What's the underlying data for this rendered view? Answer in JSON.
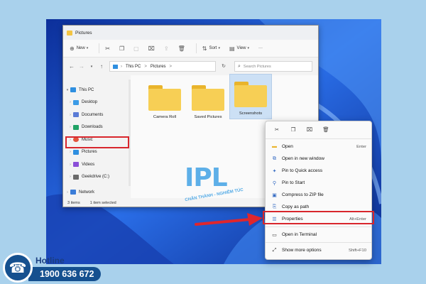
{
  "window": {
    "title": "Pictures"
  },
  "toolbar": {
    "new_label": "New",
    "sort_label": "Sort",
    "view_label": "View",
    "more_label": "···"
  },
  "address": {
    "crumbs": [
      "This PC",
      ">",
      "Pictures",
      ">"
    ],
    "search_placeholder": "Search Pictures"
  },
  "nav": {
    "items": [
      {
        "label": "This PC",
        "icon": "computer-icon",
        "color": "#2f8fe0"
      },
      {
        "label": "Desktop",
        "icon": "desktop-icon",
        "color": "#3b9be6"
      },
      {
        "label": "Documents",
        "icon": "documents-icon",
        "color": "#5a7bd6"
      },
      {
        "label": "Downloads",
        "icon": "downloads-icon",
        "color": "#21a366"
      },
      {
        "label": "Music",
        "icon": "music-icon",
        "color": "#e2533d"
      },
      {
        "label": "Pictures",
        "icon": "pictures-icon",
        "color": "#2f8fe0"
      },
      {
        "label": "Videos",
        "icon": "videos-icon",
        "color": "#8b4fd8"
      },
      {
        "label": "Geekdrive (C:)",
        "icon": "drive-icon",
        "color": "#6b6b6b"
      },
      {
        "label": "Network",
        "icon": "network-icon",
        "color": "#3b7dd8"
      }
    ]
  },
  "files": [
    {
      "name": "Camera Roll"
    },
    {
      "name": "Saved Pictures"
    },
    {
      "name": "Screenshots"
    }
  ],
  "status": {
    "count": "3 items",
    "selected": "1 item selected"
  },
  "context_menu": {
    "items": [
      {
        "label": "Open",
        "shortcut": "Enter",
        "icon": "open-icon"
      },
      {
        "label": "Open in new window",
        "shortcut": "",
        "icon": "new-window-icon"
      },
      {
        "label": "Pin to Quick access",
        "shortcut": "",
        "icon": "pin-icon"
      },
      {
        "label": "Pin to Start",
        "shortcut": "",
        "icon": "pin-start-icon"
      },
      {
        "label": "Compress to ZIP file",
        "shortcut": "",
        "icon": "zip-icon"
      },
      {
        "label": "Copy as path",
        "shortcut": "",
        "icon": "copy-path-icon"
      },
      {
        "label": "Properties",
        "shortcut": "Alt+Enter",
        "icon": "properties-icon"
      },
      {
        "label": "Open in Terminal",
        "shortcut": "",
        "icon": "terminal-icon"
      },
      {
        "label": "Show more options",
        "shortcut": "Shift+F10",
        "icon": "more-options-icon"
      }
    ]
  },
  "watermark": {
    "logo_text": "IPL",
    "tagline": "CHÂN THÀNH - NGHIÊM TÚC"
  },
  "hotline": {
    "label": "Hotline",
    "number": "1900 636 672"
  },
  "colors": {
    "highlight": "#d8262c",
    "folder": "#f7cf55",
    "hotline_bg": "#15508f"
  }
}
